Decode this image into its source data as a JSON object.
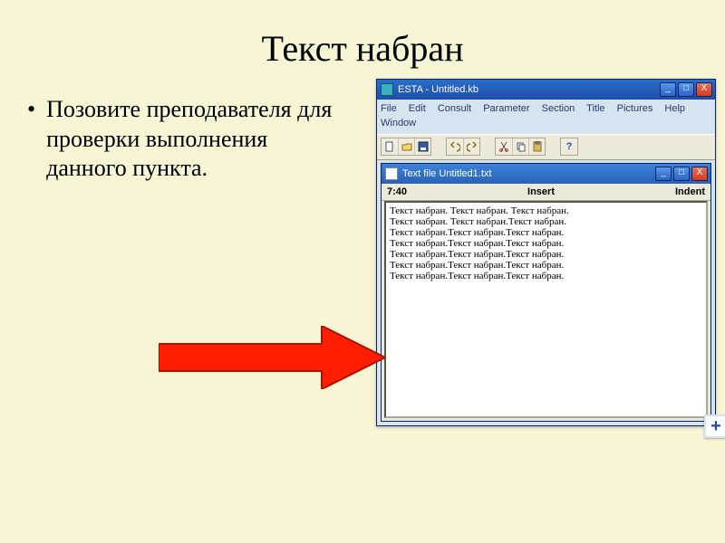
{
  "slide": {
    "title": "Текст набран",
    "bullet": "Позовите преподавателя для проверки выполнения данного пункта."
  },
  "outer_window": {
    "title": "ESTA - Untitled.kb",
    "btn_min": "_",
    "btn_max": "□",
    "btn_close": "X",
    "menu": {
      "file": "File",
      "edit": "Edit",
      "consult": "Consult",
      "parameter": "Parameter",
      "section": "Section",
      "title": "Title",
      "pictures": "Pictures",
      "help": "Help",
      "window": "Window"
    },
    "help_glyph": "?"
  },
  "inner_window": {
    "title": "Text file Untitled1.txt",
    "status": {
      "left": "7:40",
      "center": "Insert",
      "right": "Indent"
    },
    "lines": [
      "Текст набран. Текст набран. Текст набран.",
      "Текст набран. Текст набран.Текст набран.",
      "Текст набран.Текст набран.Текст набран.",
      "Текст набран.Текст набран.Текст набран.",
      "Текст набран.Текст набран.Текст набран.",
      "Текст набран.Текст набран.Текст набран.",
      "Текст набран.Текст набран.Текст набран."
    ]
  },
  "plus": "+"
}
